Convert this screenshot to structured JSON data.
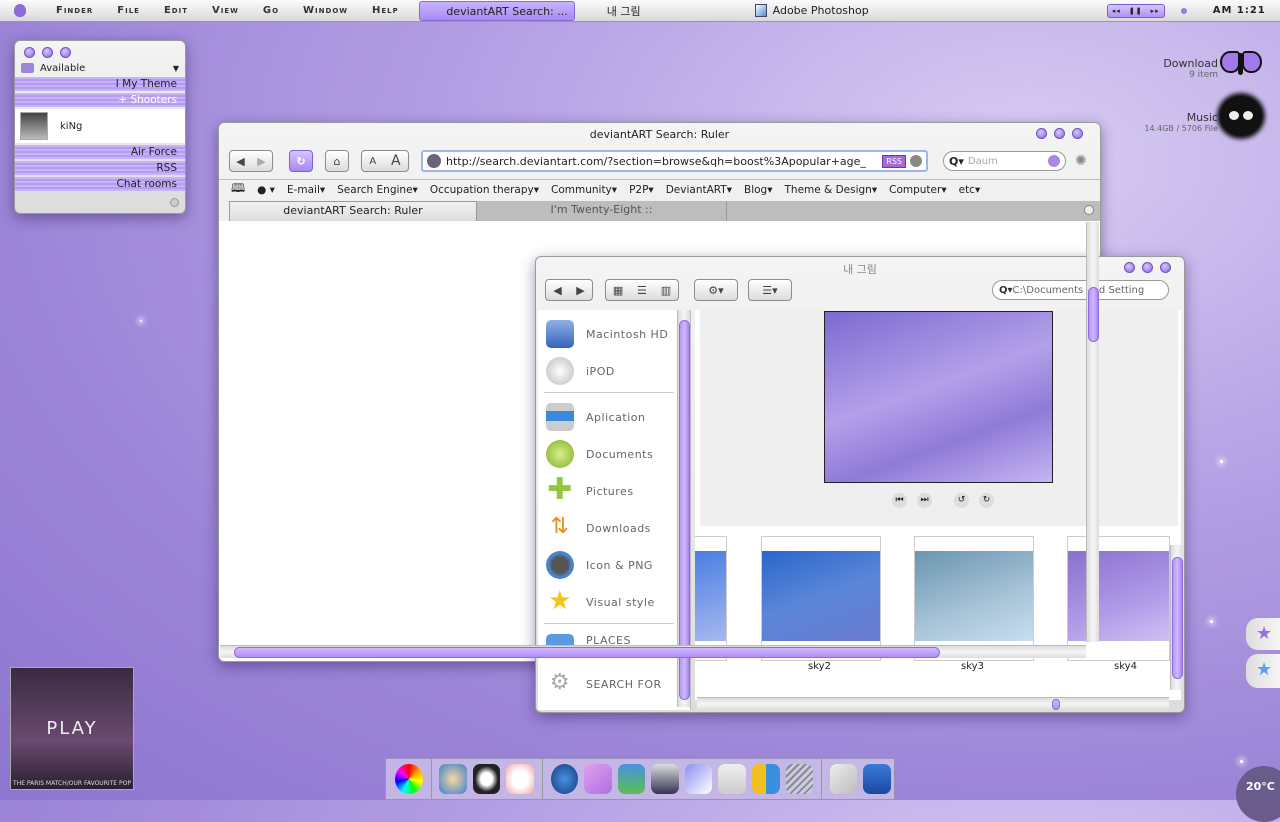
{
  "menubar": {
    "items": [
      "Finder",
      "File",
      "Edit",
      "View",
      "Go",
      "Window",
      "Help"
    ],
    "active_window": "deviantART Search: ...",
    "window2": "내 그림",
    "app": "Adobe Photoshop",
    "media_controls": [
      "◂◂",
      "❚❚",
      "▸▸"
    ],
    "clock": "AM 1:21"
  },
  "buddy": {
    "status": "Available",
    "groups": [
      "I My Theme",
      "+ Shooters"
    ],
    "contact": "kiNg",
    "groups2": [
      "Air Force",
      "RSS",
      "Chat rooms"
    ]
  },
  "widgets": {
    "download_label": "Download",
    "download_count": "9  item",
    "music_label": "Music",
    "music_info": "14.4GB / 5706 File",
    "temperature": "20°C",
    "album_text": "PLAY",
    "album_caption": "THE PARIS MATCH/OUR FAVOURITE POP"
  },
  "browser": {
    "title": "deviantART Search: Ruler",
    "url": "http://search.deviantart.com/?section=browse&qh=boost%3Apopular+age_",
    "rss": "RSS",
    "search_placeholder": "Daum",
    "font_small": "A",
    "font_large": "A",
    "bookmarks": [
      "E-mail",
      "Search Engine",
      "Occupation therapy",
      "Community",
      "P2P",
      "DeviantART",
      "Blog",
      "Theme & Design",
      "Computer",
      "etc"
    ],
    "tabs": [
      {
        "label": "deviantART Search: Ruler",
        "active": true
      },
      {
        "label": "I'm Twenty-Eight ::",
        "active": false
      }
    ],
    "scroll_h_fraction": 0.8
  },
  "finder": {
    "title": "내 그림",
    "search_value": "C:\\Documents and Setting",
    "sidebar": [
      "Macintosh HD",
      "iPOD",
      "Aplication",
      "Documents",
      "Pictures",
      "Downloads",
      "Icon & PNG",
      "Visual style",
      "PLACES",
      "SEARCH FOR"
    ],
    "thumbnails": [
      "sky2",
      "sky3",
      "sky4"
    ],
    "colors": {
      "accent": "#b796f7"
    }
  }
}
